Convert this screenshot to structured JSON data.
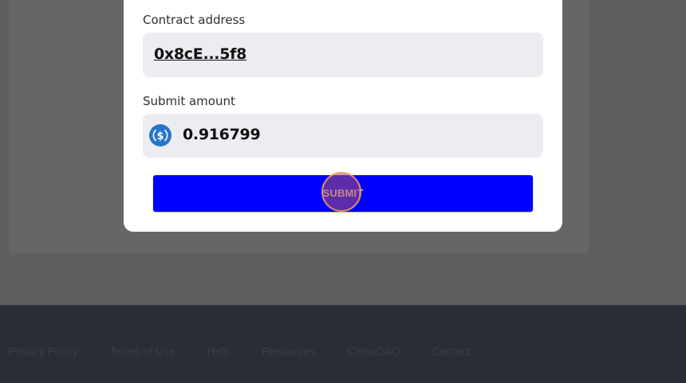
{
  "modal": {
    "contract_label": "Contract address",
    "contract_address": "0x8cE...5f8",
    "amount_label": "Submit amount",
    "amount_value": "0.916799",
    "token_icon": "usdc-dollar-coin-icon",
    "submit_label": "SUBMIT"
  },
  "footer": {
    "links": [
      "Privacy Policy",
      "Terms of Use",
      "Help",
      "Resources",
      "ClimaDAO",
      "Contact"
    ]
  },
  "colors": {
    "accent": "#0000fe",
    "token": "#2775ca",
    "field_bg": "#ecedf1",
    "footer_bg": "#2b2d36"
  }
}
